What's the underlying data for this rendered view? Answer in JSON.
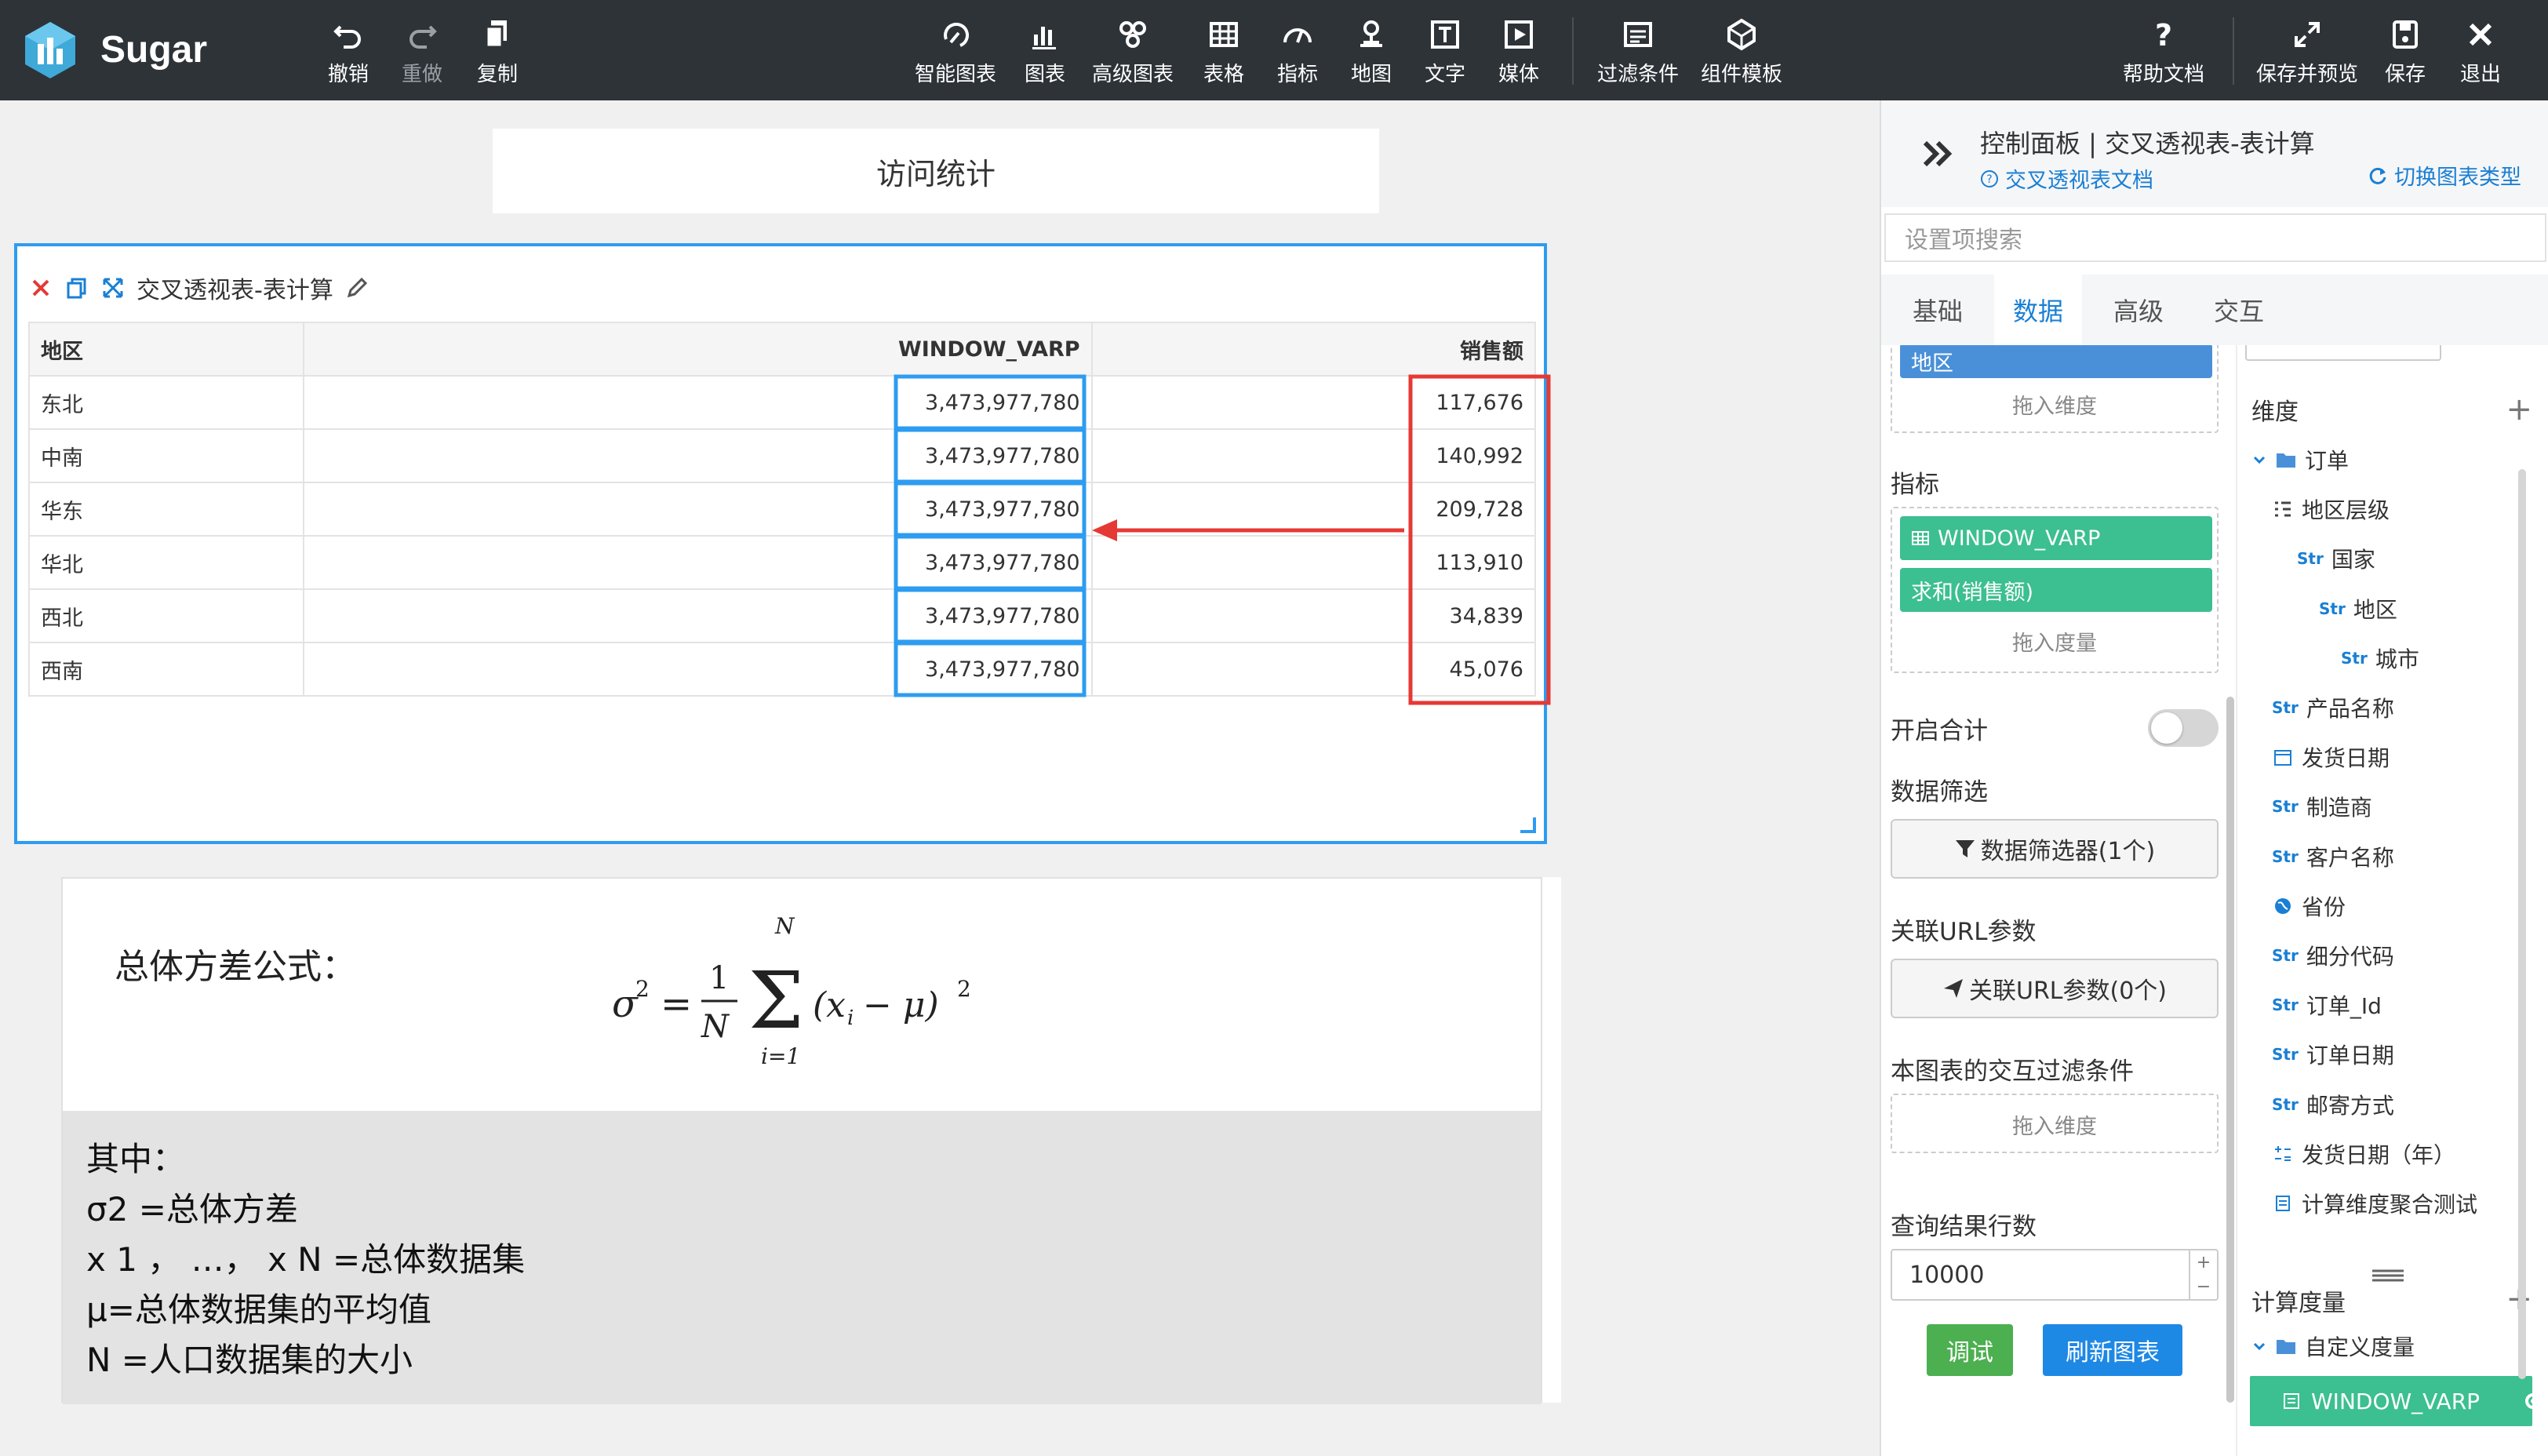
{
  "app": {
    "brand": "Sugar"
  },
  "toolbar": {
    "undo": "撤销",
    "redo": "重做",
    "copy": "复制",
    "smart_chart": "智能图表",
    "chart": "图表",
    "advanced_chart": "高级图表",
    "table": "表格",
    "indicator": "指标",
    "map": "地图",
    "text": "文字",
    "media": "媒体",
    "filter": "过滤条件",
    "component_template": "组件模板",
    "help": "帮助文档",
    "save_preview": "保存并预览",
    "save": "保存",
    "exit": "退出"
  },
  "canvas": {
    "page_title": "访问统计",
    "widget": {
      "title": "交叉透视表-表计算",
      "columns": [
        "地区",
        "WINDOW_VARP",
        "销售额"
      ],
      "rows": [
        [
          "东北",
          "3,473,977,780",
          "117,676"
        ],
        [
          "中南",
          "3,473,977,780",
          "140,992"
        ],
        [
          "华东",
          "3,473,977,780",
          "209,728"
        ],
        [
          "华北",
          "3,473,977,780",
          "113,910"
        ],
        [
          "西北",
          "3,473,977,780",
          "34,839"
        ],
        [
          "西南",
          "3,473,977,780",
          "45,076"
        ]
      ]
    },
    "formula": {
      "label": "总体方差公式：",
      "lines": [
        "其中：",
        "σ2 =总体方差",
        "x 1 ， …， x N =总体数据集",
        "μ=总体数据集的平均值",
        "N =人口数据集的大小"
      ]
    }
  },
  "panel": {
    "title": "控制面板 | 交叉透视表-表计算",
    "doc_link": "交叉透视表文档",
    "switch_link": "切换图表类型",
    "search_placeholder": "设置项搜索",
    "tabs": [
      "基础",
      "数据",
      "高级",
      "交互"
    ],
    "active_tab": "数据",
    "left": {
      "dim_pill": "地区",
      "drop_dimension": "拖入维度",
      "metrics_label": "指标",
      "metric_pills": [
        "WINDOW_VARP",
        "求和(销售额)"
      ],
      "drop_measure": "拖入度量",
      "total_label": "开启合计",
      "filter_label": "数据筛选",
      "filter_button": "数据筛选器(1个)",
      "url_label": "关联URL参数",
      "url_button": "关联URL参数(0个)",
      "interact_label": "本图表的交互过滤条件",
      "interact_drop": "拖入维度",
      "rows_label": "查询结果行数",
      "rows_value": "10000",
      "debug_button": "调试",
      "refresh_button": "刷新图表"
    },
    "right": {
      "dim_header": "维度",
      "tree": [
        {
          "label": "订单",
          "type": "folder"
        },
        {
          "label": "地区层级",
          "type": "hier"
        },
        {
          "label": "国家",
          "type": "Str"
        },
        {
          "label": "地区",
          "type": "Str"
        },
        {
          "label": "城市",
          "type": "Str"
        },
        {
          "label": "产品名称",
          "type": "Str"
        },
        {
          "label": "发货日期",
          "type": "date"
        },
        {
          "label": "制造商",
          "type": "Str"
        },
        {
          "label": "客户名称",
          "type": "Str"
        },
        {
          "label": "省份",
          "type": "geo"
        },
        {
          "label": "细分代码",
          "type": "Str"
        },
        {
          "label": "订单_Id",
          "type": "Str"
        },
        {
          "label": "订单日期",
          "type": "Str"
        },
        {
          "label": "邮寄方式",
          "type": "Str"
        },
        {
          "label": "发货日期（年）",
          "type": "calc"
        },
        {
          "label": "计算维度聚合测试",
          "type": "calcdim"
        }
      ],
      "str_tag": "Str",
      "measure_header": "计算度量",
      "measure_folder": "自定义度量",
      "measure_item": "WINDOW_VARP"
    }
  },
  "colors": {
    "toolbar_bg": "#2e3338",
    "accent_blue": "#2e9cf0",
    "highlight_red": "#e53935",
    "pill_green": "#3cbf91",
    "pill_blue": "#4a90d9"
  }
}
